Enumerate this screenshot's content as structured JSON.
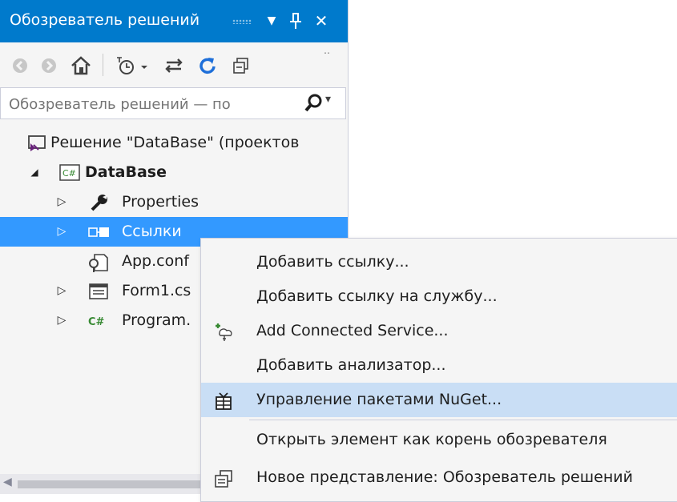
{
  "titlebar": {
    "title": "Обозреватель решений",
    "dropdown_glyph": "▼",
    "pin_glyph": "ᚌ",
    "close_glyph": "✕"
  },
  "toolbar": {
    "back_icon": "back-icon",
    "forward_icon": "forward-icon",
    "home_icon": "home-icon",
    "pending_changes_icon": "clock-filter-icon",
    "sync_icon": "sync-icon",
    "refresh_icon": "refresh-icon",
    "collapse_icon": "collapse-all-icon",
    "overflow_glyph": "‥"
  },
  "search": {
    "placeholder": "Обозреватель решений — по",
    "icon": "search-icon",
    "dropdown_glyph": "▾"
  },
  "tree": {
    "solution": {
      "label": "Решение \"DataBase\"  (проектов",
      "icon": "solution-icon"
    },
    "project": {
      "label": "DataBase",
      "icon": "csharp-project-icon",
      "expander": "◢"
    },
    "items": [
      {
        "label": "Properties",
        "icon": "wrench-icon",
        "expander": "▷"
      },
      {
        "label": "Ссылки",
        "icon": "references-icon",
        "expander": "▷"
      },
      {
        "label": "App.conf",
        "icon": "config-file-icon",
        "expander": ""
      },
      {
        "label": "Form1.cs",
        "icon": "form-icon",
        "expander": "▷"
      },
      {
        "label": "Program.",
        "icon": "csharp-file-icon",
        "expander": "▷"
      }
    ]
  },
  "context_menu": {
    "items": [
      {
        "label": "Добавить ссылку...",
        "icon": ""
      },
      {
        "label": "Добавить ссылку на службу...",
        "icon": ""
      },
      {
        "label": "Add Connected Service...",
        "icon": "connected-service-icon"
      },
      {
        "label": "Добавить анализатор...",
        "icon": ""
      },
      {
        "label": "Управление пакетами NuGet...",
        "icon": "nuget-icon"
      },
      {
        "label": "Открыть элемент как корень обозревателя",
        "icon": ""
      },
      {
        "label": "Новое представление: Обозреватель решений",
        "icon": "new-view-icon"
      }
    ]
  },
  "colors": {
    "accent": "#007acc",
    "selection": "#3399ff",
    "menu_highlight": "#c9def5"
  }
}
